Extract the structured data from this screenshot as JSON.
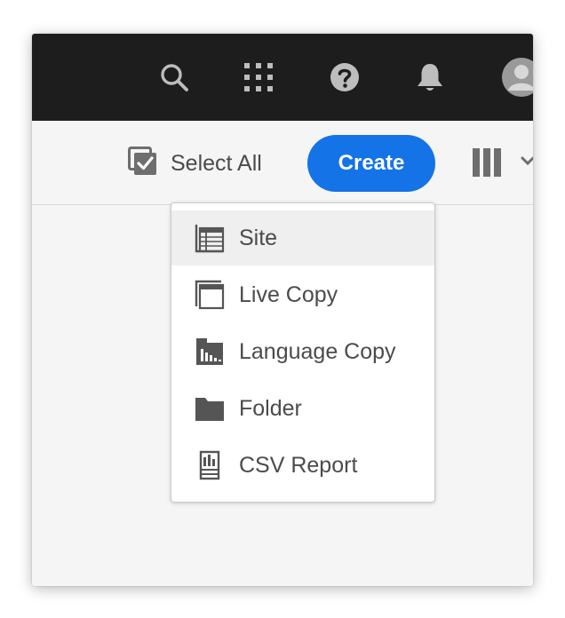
{
  "header": {
    "icons": [
      "search-icon",
      "apps-grid-icon",
      "help-icon",
      "notifications-bell-icon",
      "user-avatar"
    ]
  },
  "toolbar": {
    "select_all_label": "Select All",
    "create_label": "Create"
  },
  "create_menu": {
    "items": [
      {
        "label": "Site",
        "icon": "site-icon"
      },
      {
        "label": "Live Copy",
        "icon": "live-copy-icon"
      },
      {
        "label": "Language Copy",
        "icon": "language-copy-icon"
      },
      {
        "label": "Folder",
        "icon": "folder-icon"
      },
      {
        "label": "CSV Report",
        "icon": "csv-report-icon"
      }
    ]
  },
  "colors": {
    "header_bg": "#1d1d1d",
    "accent": "#1473e6",
    "menu_hover": "#efefef",
    "text": "#4b4b4b"
  }
}
